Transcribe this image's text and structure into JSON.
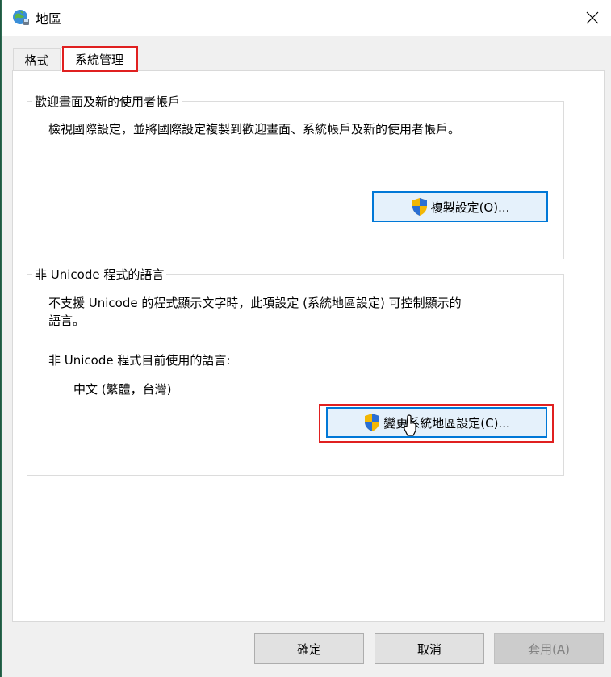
{
  "window": {
    "title": "地區",
    "icon": "globe-icon",
    "close_icon": "close-icon"
  },
  "tabs": [
    {
      "label": "格式",
      "active": false
    },
    {
      "label": "系統管理",
      "active": true
    }
  ],
  "welcome_group": {
    "title": "歡迎畫面及新的使用者帳戶",
    "description": "檢視國際設定，並將國際設定複製到歡迎畫面、系統帳戶及新的使用者帳戶。",
    "copy_button": "複製設定(O)..."
  },
  "non_unicode_group": {
    "title": "非 Unicode 程式的語言",
    "description_line1": "不支援 Unicode 的程式顯示文字時，此項設定 (系統地區設定) 可控制顯示的",
    "description_line2": "語言。",
    "current_label": "非 Unicode 程式目前使用的語言:",
    "current_value": "中文 (繁體，台灣)",
    "change_button": "變更系統地區設定(C)..."
  },
  "footer": {
    "ok": "確定",
    "cancel": "取消",
    "apply": "套用(A)"
  },
  "colors": {
    "accent": "#0078d7",
    "highlight_red": "#e02020",
    "shield_blue": "#2a6fd4",
    "shield_yellow": "#f2b705"
  }
}
